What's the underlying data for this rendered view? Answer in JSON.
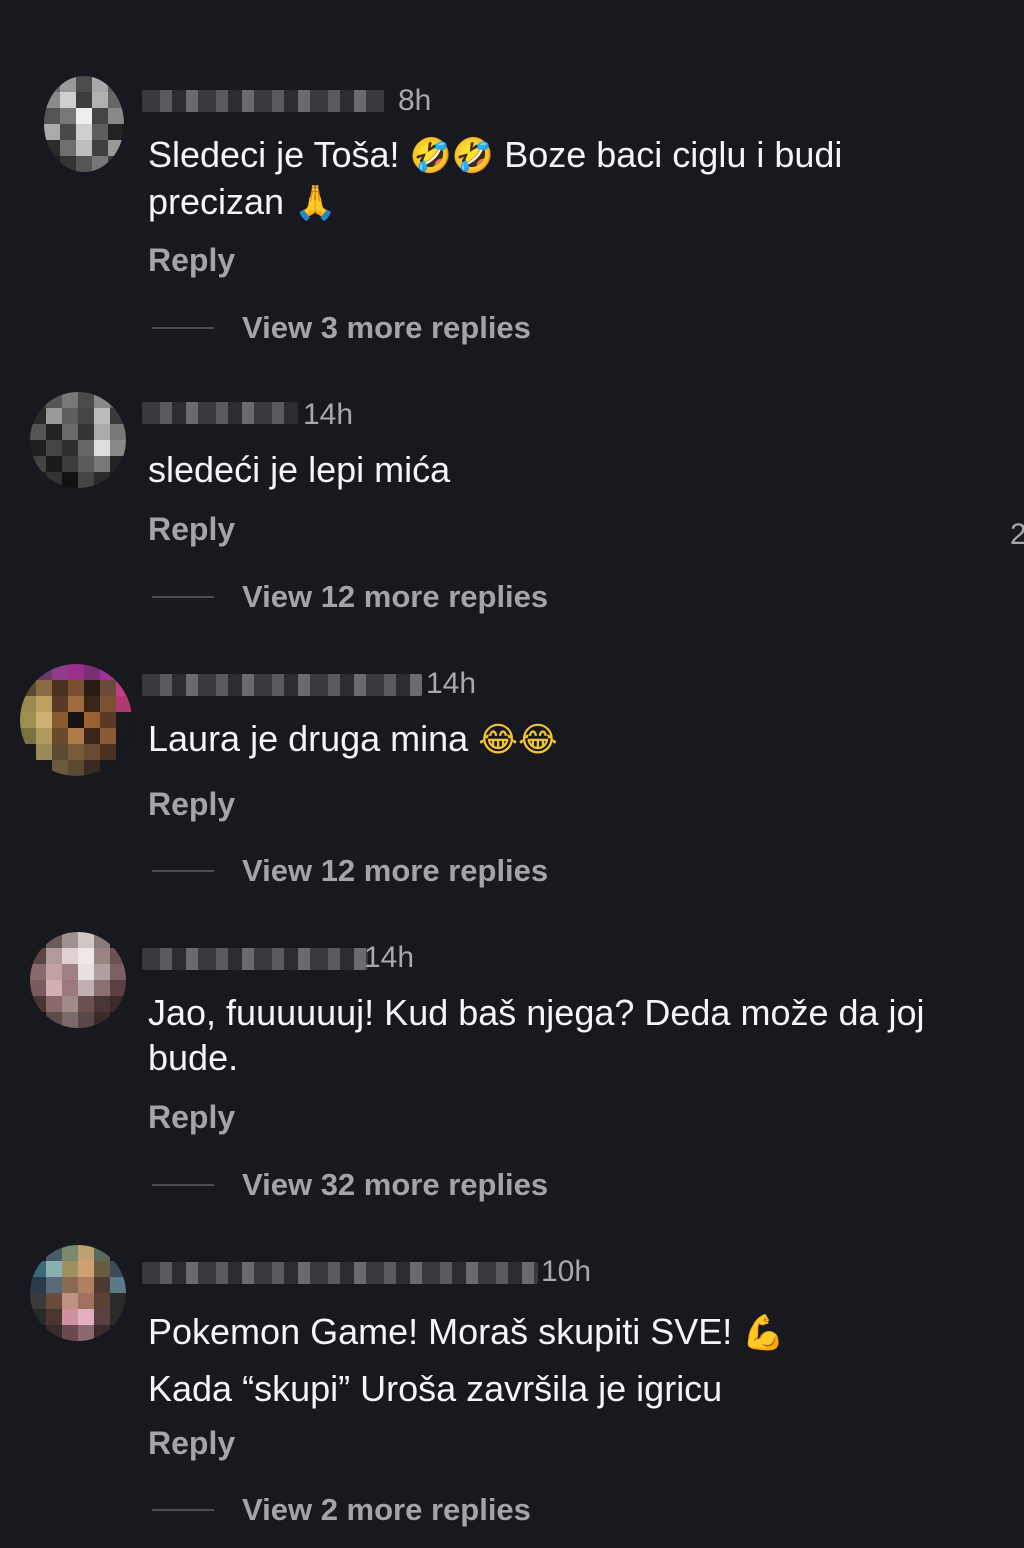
{
  "comments": [
    {
      "time": "8h",
      "text": "Sledeci je Toša!",
      "emoji_a": "🤣🤣",
      "text_b": "Boze baci ciglu i budi precizan",
      "emoji_b": "🙏",
      "reply": "Reply",
      "view_more": "View 3 more replies"
    },
    {
      "time": "14h",
      "text": "sledeći je lepi mića",
      "reply": "Reply",
      "view_more": "View 12 more replies"
    },
    {
      "time": "14h",
      "text": "Laura je druga mina",
      "emoji_a": "😂😂",
      "reply": "Reply",
      "view_more": "View 12 more replies"
    },
    {
      "time": "14h",
      "text": "Jao, fuuuuuuj! Kud baš njega? Deda može da joj bude.",
      "reply": "Reply",
      "view_more": "View 32 more replies"
    },
    {
      "time": "10h",
      "text": "Pokemon Game! Moraš skupiti SVE!",
      "emoji_a": "💪",
      "text_b": "Kada “skupi” Uroša završila je igricu",
      "reply": "Reply",
      "view_more": "View 2 more replies"
    }
  ],
  "edge_digit": "2",
  "icons": {
    "avatar": "blurred-avatar-icon"
  },
  "colors": {
    "background": "#17191e",
    "text": "#f5f5f5",
    "muted": "#a3a4a8"
  }
}
